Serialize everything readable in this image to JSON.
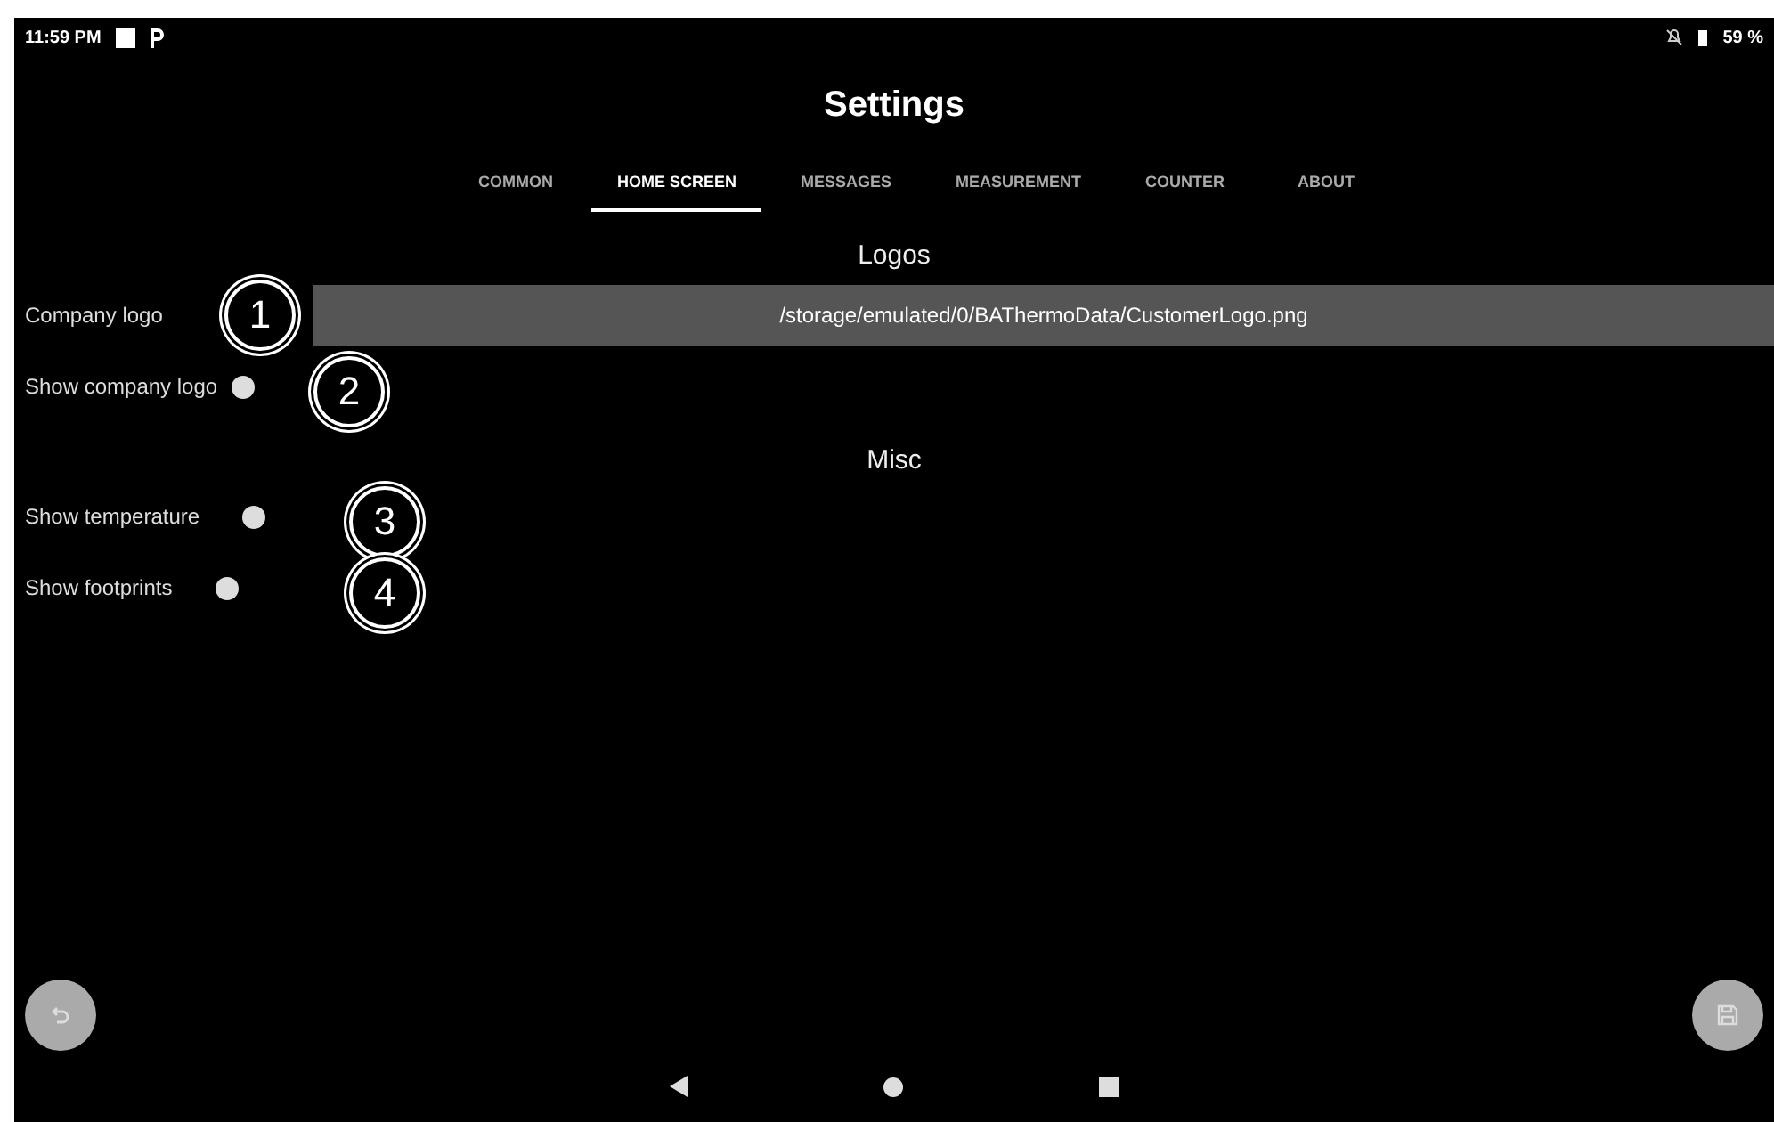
{
  "status_bar": {
    "time": "11:59 PM",
    "battery": "59 %"
  },
  "title": "Settings",
  "tabs": [
    {
      "label": "COMMON",
      "selected": false
    },
    {
      "label": "HOME SCREEN",
      "selected": true
    },
    {
      "label": "MESSAGES",
      "selected": false
    },
    {
      "label": "MEASUREMENT",
      "selected": false
    },
    {
      "label": "COUNTER",
      "selected": false
    },
    {
      "label": "ABOUT",
      "selected": false
    }
  ],
  "sections": [
    {
      "heading": "Logos",
      "rows": [
        {
          "kind": "path",
          "label": "Company logo",
          "value": "/storage/emulated/0/BAThermoData/CustomerLogo.png",
          "callout": "1"
        },
        {
          "kind": "switch",
          "label": "Show company logo",
          "on": false,
          "callout": "2"
        }
      ]
    },
    {
      "heading": "Misc",
      "rows": [
        {
          "kind": "switch",
          "label": "Show temperature",
          "on": false,
          "callout": "3"
        },
        {
          "kind": "switch",
          "label": "Show footprints",
          "on": false,
          "callout": "4"
        }
      ]
    }
  ]
}
